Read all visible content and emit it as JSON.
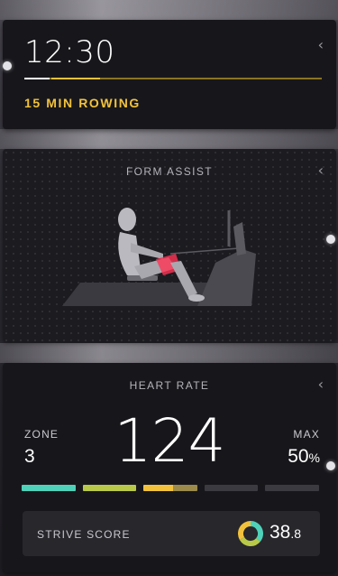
{
  "timer": {
    "value": "12:30",
    "progress_fraction": 0.25,
    "workout_label": "15 MIN ROWING"
  },
  "form_assist": {
    "title": "FORM ASSIST",
    "highlight_color": "#ff3355"
  },
  "heart_rate": {
    "title": "HEART RATE",
    "zone_label": "ZONE",
    "zone_value": "3",
    "bpm": "124",
    "max_label": "MAX",
    "max_value": "50",
    "max_unit": "%",
    "zone_colors": [
      "#4fd1b9",
      "#b8c94a",
      "#f2c23c",
      "#3a3a40",
      "#3a3a40"
    ]
  },
  "strive": {
    "label": "STRIVE SCORE",
    "value_main": "38",
    "value_dec": ".8",
    "ring_colors": [
      "#4fd1b9",
      "#b8c94a",
      "#f2c23c"
    ]
  },
  "icons": {
    "collapse": "chevron-left-icon",
    "side_handle": "side-handle-dot"
  },
  "chevron_glyph": "‹"
}
